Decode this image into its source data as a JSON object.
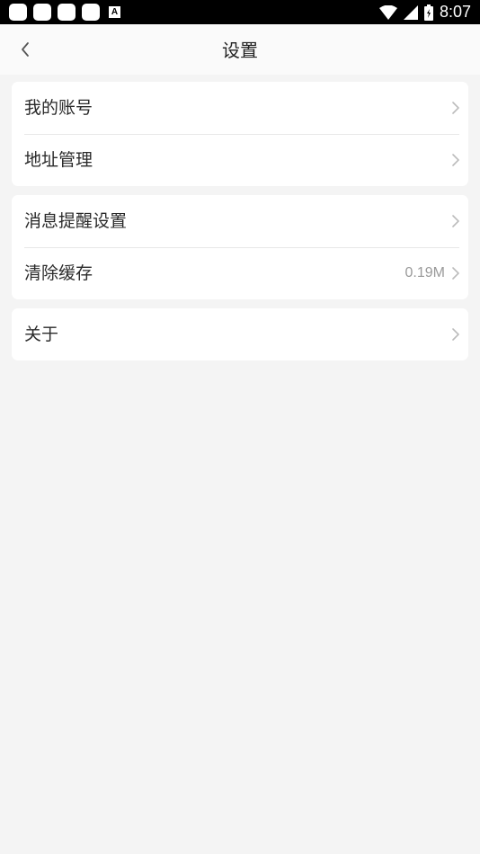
{
  "status_bar": {
    "time": "8:07",
    "left_icons": [
      "notification-square-icon",
      "notification-square-icon",
      "notification-square-icon",
      "notification-square-icon",
      "a-icon"
    ],
    "right_icons": [
      "wifi-icon",
      "signal-icon",
      "battery-icon"
    ]
  },
  "nav": {
    "title": "设置",
    "back_icon": "chevron-left-icon"
  },
  "groups": [
    {
      "items": [
        {
          "label": "我的账号"
        },
        {
          "label": "地址管理"
        }
      ]
    },
    {
      "items": [
        {
          "label": "消息提醒设置"
        },
        {
          "label": "清除缓存",
          "value": "0.19M"
        }
      ]
    },
    {
      "items": [
        {
          "label": "关于"
        }
      ]
    }
  ],
  "colors": {
    "background": "#f4f4f4",
    "card": "#ffffff",
    "text": "#2a2a2a",
    "secondary_text": "#999999",
    "chevron": "#bbbbbb"
  }
}
